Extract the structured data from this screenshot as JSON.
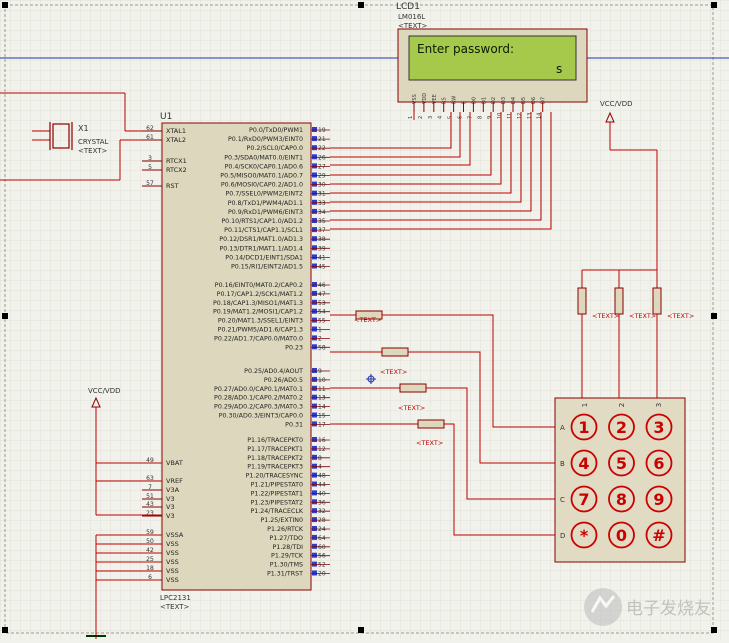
{
  "lcd": {
    "ref": "LCD1",
    "part": "LM016L",
    "text_tag": "<TEXT>",
    "line1": "Enter password:",
    "line2": "s",
    "pins": [
      "VSS",
      "VDD",
      "VEE",
      "RS",
      "RW",
      "E",
      "D0",
      "D1",
      "D2",
      "D3",
      "D4",
      "D5",
      "D6",
      "D7"
    ],
    "pin_numbers": [
      "1",
      "2",
      "3",
      "4",
      "5",
      "6",
      "7",
      "8",
      "9",
      "10",
      "11",
      "12",
      "13",
      "14"
    ]
  },
  "crystal": {
    "ref": "X1",
    "type": "CRYSTAL",
    "text_tag": "<TEXT>"
  },
  "mcu": {
    "ref": "U1",
    "part": "LPC2131",
    "text_tag": "<TEXT>",
    "left_pins": [
      {
        "num": "62",
        "name": "XTAL1"
      },
      {
        "num": "61",
        "name": "XTAL2"
      },
      {
        "num": "3",
        "name": "RTCX1"
      },
      {
        "num": "5",
        "name": "RTCX2"
      },
      {
        "num": "57",
        "name": "RST"
      },
      {
        "num": "49",
        "name": "VBAT"
      },
      {
        "num": "63",
        "name": "VREF"
      },
      {
        "num": "7",
        "name": "V3A"
      },
      {
        "num": "51",
        "name": "V3"
      },
      {
        "num": "43",
        "name": "V3"
      },
      {
        "num": "23",
        "name": "V3"
      },
      {
        "num": "59",
        "name": "VSSA"
      },
      {
        "num": "50",
        "name": "VSS"
      },
      {
        "num": "42",
        "name": "VSS"
      },
      {
        "num": "25",
        "name": "VSS"
      },
      {
        "num": "18",
        "name": "VSS"
      },
      {
        "num": "6",
        "name": "VSS"
      }
    ],
    "right_pins": [
      {
        "num": "19",
        "name": "P0.0/TxD0/PWM1"
      },
      {
        "num": "21",
        "name": "P0.1/RxD0/PWM3/EINT0"
      },
      {
        "num": "22",
        "name": "P0.2/SCL0/CAP0.0"
      },
      {
        "num": "26",
        "name": "P0.3/SDA0/MAT0.0/EINT1"
      },
      {
        "num": "27",
        "name": "P0.4/SCK0/CAP0.1/AD0.6"
      },
      {
        "num": "29",
        "name": "P0.5/MISO0/MAT0.1/AD0.7"
      },
      {
        "num": "30",
        "name": "P0.6/MOSI0/CAP0.2/AD1.0"
      },
      {
        "num": "31",
        "name": "P0.7/SSEL0/PWM2/EINT2"
      },
      {
        "num": "33",
        "name": "P0.8/TxD1/PWM4/AD1.1"
      },
      {
        "num": "34",
        "name": "P0.9/RxD1/PWM6/EINT3"
      },
      {
        "num": "35",
        "name": "P0.10/RTS1/CAP1.0/AD1.2"
      },
      {
        "num": "37",
        "name": "P0.11/CTS1/CAP1.1/SCL1"
      },
      {
        "num": "38",
        "name": "P0.12/DSR1/MAT1.0/AD1.3"
      },
      {
        "num": "39",
        "name": "P0.13/DTR1/MAT1.1/AD1.4"
      },
      {
        "num": "41",
        "name": "P0.14/DCD1/EINT1/SDA1"
      },
      {
        "num": "45",
        "name": "P0.15/RI1/EINT2/AD1.5"
      },
      {
        "num": "46",
        "name": "P0.16/EINT0/MAT0.2/CAP0.2"
      },
      {
        "num": "47",
        "name": "P0.17/CAP1.2/SCK1/MAT1.2"
      },
      {
        "num": "53",
        "name": "P0.18/CAP1.3/MISO1/MAT1.3"
      },
      {
        "num": "54",
        "name": "P0.19/MAT1.2/MOSI1/CAP1.2"
      },
      {
        "num": "55",
        "name": "P0.20/MAT1.3/SSEL1/EINT3"
      },
      {
        "num": "1",
        "name": "P0.21/PWM5/AD1.6/CAP1.3"
      },
      {
        "num": "2",
        "name": "P0.22/AD1.7/CAP0.0/MAT0.0"
      },
      {
        "num": "58",
        "name": "P0.23"
      },
      {
        "num": "9",
        "name": "P0.25/AD0.4/AOUT"
      },
      {
        "num": "10",
        "name": "P0.26/AD0.5"
      },
      {
        "num": "11",
        "name": "P0.27/AD0.0/CAP0.1/MAT0.1"
      },
      {
        "num": "13",
        "name": "P0.28/AD0.1/CAP0.2/MAT0.2"
      },
      {
        "num": "14",
        "name": "P0.29/AD0.2/CAP0.3/MAT0.3"
      },
      {
        "num": "15",
        "name": "P0.30/AD0.3/EINT3/CAP0.0"
      },
      {
        "num": "17",
        "name": "P0.31"
      },
      {
        "num": "16",
        "name": "P1.16/TRACEPKT0"
      },
      {
        "num": "12",
        "name": "P1.17/TRACEPKT1"
      },
      {
        "num": "8",
        "name": "P1.18/TRACEPKT2"
      },
      {
        "num": "4",
        "name": "P1.19/TRACEPKT3"
      },
      {
        "num": "48",
        "name": "P1.20/TRACESYNC"
      },
      {
        "num": "44",
        "name": "P1.21/PIPESTAT0"
      },
      {
        "num": "40",
        "name": "P1.22/PIPESTAT1"
      },
      {
        "num": "36",
        "name": "P1.23/PIPESTAT2"
      },
      {
        "num": "32",
        "name": "P1.24/TRACECLK"
      },
      {
        "num": "28",
        "name": "P1.25/EXTIN0"
      },
      {
        "num": "24",
        "name": "P1.26/RTCK"
      },
      {
        "num": "64",
        "name": "P1.27/TDO"
      },
      {
        "num": "60",
        "name": "P1.28/TDI"
      },
      {
        "num": "56",
        "name": "P1.29/TCK"
      },
      {
        "num": "52",
        "name": "P1.30/TMS"
      },
      {
        "num": "20",
        "name": "P1.31/TRST"
      }
    ]
  },
  "power": {
    "vcc_left": "VCC/VDD",
    "vcc_right": "VCC/VDD"
  },
  "resistor_text": "<TEXT>",
  "keypad": {
    "columns": [
      "1",
      "2",
      "3"
    ],
    "rows": [
      "A",
      "B",
      "C",
      "D"
    ],
    "keys": [
      "1",
      "2",
      "3",
      "4",
      "5",
      "6",
      "7",
      "8",
      "9",
      "*",
      "0",
      "#"
    ]
  },
  "watermark": "电子发烧友",
  "colors": {
    "wire": "#c00000",
    "chip_fill": "#ddd8bd",
    "lcd_screen": "#a6c94c",
    "keypad_fill": "#e0dbc2",
    "pin_blue": "#2e3cc8",
    "grid": "#d6d6cc",
    "background": "#f2f2ec"
  }
}
